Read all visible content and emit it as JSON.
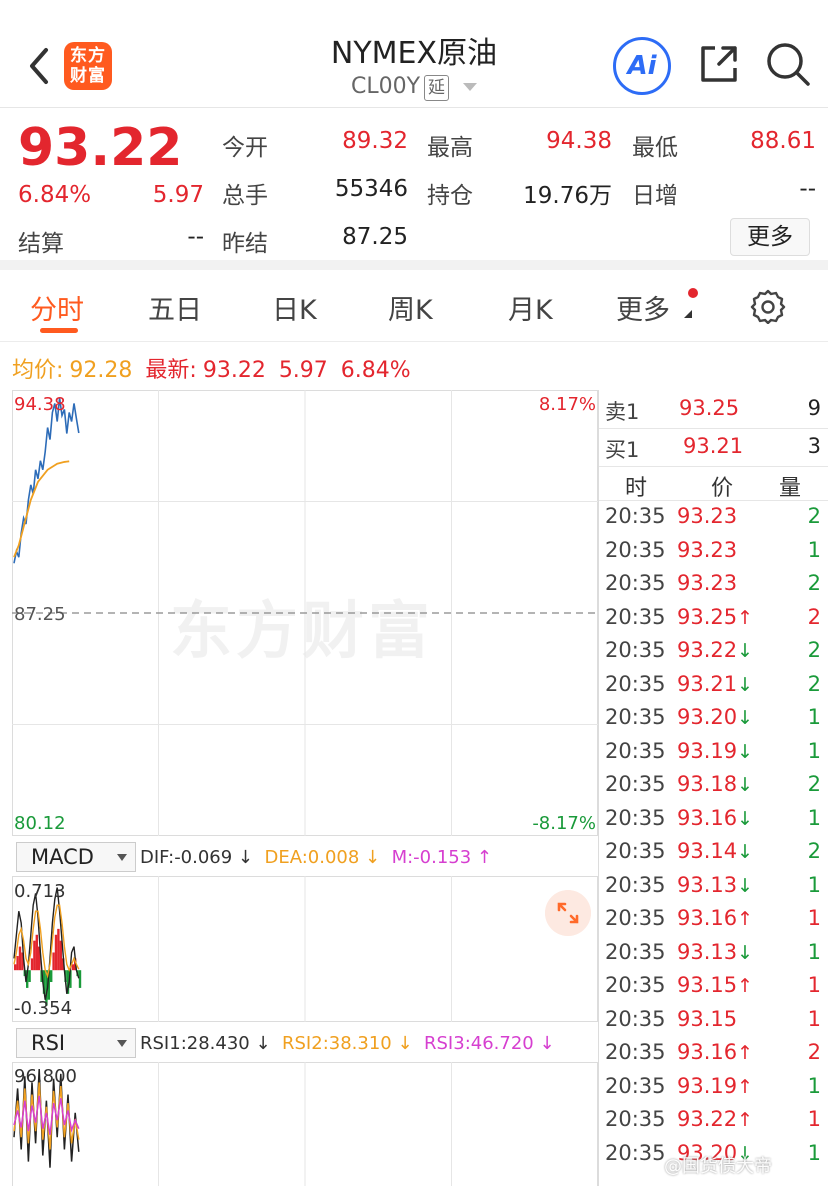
{
  "header": {
    "title": "NYMEX原油",
    "code": "CL00Y",
    "delay_badge": "延",
    "logo_line1": "东方",
    "logo_line2": "财富",
    "ai_label": "Ai"
  },
  "quote": {
    "price": "93.22",
    "pct": "6.84%",
    "change": "5.97",
    "fields": [
      {
        "label": "今开",
        "value": "89.32",
        "color": "#e3262e"
      },
      {
        "label": "最高",
        "value": "94.38",
        "color": "#e3262e"
      },
      {
        "label": "最低",
        "value": "88.61",
        "color": "#e3262e"
      },
      {
        "label": "总手",
        "value": "55346",
        "color": "#222222"
      },
      {
        "label": "持仓",
        "value": "19.76万",
        "color": "#222222"
      },
      {
        "label": "日增",
        "value": "--",
        "color": "#222222"
      },
      {
        "label": "结算",
        "value": "--",
        "color": "#222222"
      },
      {
        "label": "昨结",
        "value": "87.25",
        "color": "#222222"
      }
    ],
    "more_label": "更多"
  },
  "tabs": [
    "分时",
    "五日",
    "日K",
    "周K",
    "月K",
    "更多"
  ],
  "info_line": {
    "avg_label": "均价:",
    "avg_value": "92.28",
    "latest_label": "最新:",
    "latest_value": "93.22",
    "change": "5.97",
    "pct": "6.84%"
  },
  "chart_data": [
    {
      "type": "line",
      "title": "",
      "series": [
        {
          "name": "",
          "color": "#2d6cb8",
          "values": [
            88.9,
            89.3,
            89.1,
            89.9,
            90.4,
            90.2,
            91.0,
            91.5,
            91.2,
            92.0,
            91.7,
            92.3,
            92.0,
            92.6,
            93.4,
            93.0,
            93.9,
            94.2,
            93.6,
            94.38,
            93.8,
            94.0,
            93.2,
            93.9,
            93.6,
            94.2,
            93.7,
            93.22
          ]
        },
        {
          "name": "",
          "color": "#f0a020",
          "values": [
            89.1,
            89.3,
            89.5,
            89.8,
            90.1,
            90.4,
            90.7,
            91.0,
            91.2,
            91.4,
            91.6,
            91.7,
            91.8,
            91.9,
            92.0,
            92.05,
            92.1,
            92.15,
            92.2,
            92.22,
            92.24,
            92.26,
            92.27,
            92.28
          ]
        }
      ],
      "y_labels": {
        "top": "94.38",
        "mid": "87.25",
        "bottom": "80.12",
        "top_pct": "8.17%",
        "bottom_pct": "-8.17%"
      },
      "ylim": [
        80.12,
        94.38
      ],
      "reference": 87.25
    },
    {
      "type": "bar",
      "title": "MACD",
      "indicator_values": {
        "dif": "DIF:-0.069 ↓",
        "dea": "DEA:0.008 ↓",
        "m": "M:-0.153 ↑"
      },
      "y_labels": {
        "top": "0.713",
        "bottom": "-0.354"
      },
      "ylim": [
        -0.354,
        0.713
      ],
      "histogram": [
        0.05,
        0.12,
        0.2,
        0.15,
        -0.05,
        -0.15,
        -0.1,
        0.1,
        0.25,
        0.3,
        0.2,
        -0.1,
        -0.2,
        -0.3,
        -0.25,
        -0.1,
        0.15,
        0.3,
        0.35,
        0.25,
        0.1,
        -0.1,
        -0.2,
        -0.15,
        0.05,
        0.1,
        -0.05,
        -0.15
      ],
      "dif": [
        0.1,
        0.3,
        0.5,
        0.4,
        0.1,
        -0.1,
        0.05,
        0.3,
        0.55,
        0.65,
        0.45,
        0.15,
        -0.1,
        -0.25,
        -0.15,
        0.1,
        0.4,
        0.6,
        0.7,
        0.5,
        0.25,
        0.0,
        -0.2,
        -0.1,
        0.15,
        0.2,
        0.0,
        -0.069
      ],
      "dea": [
        0.05,
        0.15,
        0.3,
        0.35,
        0.25,
        0.1,
        0.05,
        0.15,
        0.35,
        0.5,
        0.5,
        0.35,
        0.15,
        0.0,
        -0.05,
        0.05,
        0.25,
        0.45,
        0.55,
        0.55,
        0.4,
        0.2,
        0.05,
        0.0,
        0.05,
        0.1,
        0.05,
        0.008
      ]
    },
    {
      "type": "line",
      "title": "RSI",
      "indicator_values": {
        "rsi1": "RSI1:28.430 ↓",
        "rsi2": "RSI2:38.310 ↓",
        "rsi3": "RSI3:46.720 ↓"
      },
      "y_labels": {
        "top": "96.800"
      },
      "ylim": [
        0,
        96.8
      ],
      "series": [
        {
          "name": "RSI1",
          "color": "#222222",
          "values": [
            40,
            80,
            30,
            90,
            20,
            85,
            35,
            96,
            25,
            70,
            15,
            88,
            40,
            92,
            30,
            75,
            20,
            60,
            28
          ]
        },
        {
          "name": "RSI2",
          "color": "#f0a020",
          "values": [
            45,
            70,
            40,
            80,
            35,
            75,
            45,
            85,
            38,
            65,
            30,
            78,
            48,
            82,
            40,
            68,
            35,
            55,
            38
          ]
        },
        {
          "name": "RSI3",
          "color": "#d63fd0",
          "values": [
            50,
            62,
            48,
            70,
            45,
            66,
            52,
            74,
            47,
            60,
            42,
            68,
            54,
            72,
            50,
            62,
            46,
            54,
            47
          ]
        }
      ]
    }
  ],
  "orderbook": {
    "sell_label": "卖1",
    "sell_price": "93.25",
    "sell_qty": "9",
    "buy_label": "买1",
    "buy_price": "93.21",
    "buy_qty": "3",
    "headers": [
      "时",
      "价",
      "量"
    ]
  },
  "ticks": [
    {
      "time": "20:35",
      "price": "93.23",
      "arrow": "",
      "qty": "2",
      "qty_color": "#1a9a3a"
    },
    {
      "time": "20:35",
      "price": "93.23",
      "arrow": "",
      "qty": "1",
      "qty_color": "#1a9a3a"
    },
    {
      "time": "20:35",
      "price": "93.23",
      "arrow": "",
      "qty": "2",
      "qty_color": "#1a9a3a"
    },
    {
      "time": "20:35",
      "price": "93.25",
      "arrow": "↑",
      "qty": "2",
      "qty_color": "#e3262e"
    },
    {
      "time": "20:35",
      "price": "93.22",
      "arrow": "↓",
      "qty": "2",
      "qty_color": "#1a9a3a"
    },
    {
      "time": "20:35",
      "price": "93.21",
      "arrow": "↓",
      "qty": "2",
      "qty_color": "#1a9a3a"
    },
    {
      "time": "20:35",
      "price": "93.20",
      "arrow": "↓",
      "qty": "1",
      "qty_color": "#1a9a3a"
    },
    {
      "time": "20:35",
      "price": "93.19",
      "arrow": "↓",
      "qty": "1",
      "qty_color": "#1a9a3a"
    },
    {
      "time": "20:35",
      "price": "93.18",
      "arrow": "↓",
      "qty": "2",
      "qty_color": "#1a9a3a"
    },
    {
      "time": "20:35",
      "price": "93.16",
      "arrow": "↓",
      "qty": "1",
      "qty_color": "#1a9a3a"
    },
    {
      "time": "20:35",
      "price": "93.14",
      "arrow": "↓",
      "qty": "2",
      "qty_color": "#1a9a3a"
    },
    {
      "time": "20:35",
      "price": "93.13",
      "arrow": "↓",
      "qty": "1",
      "qty_color": "#1a9a3a"
    },
    {
      "time": "20:35",
      "price": "93.16",
      "arrow": "↑",
      "qty": "1",
      "qty_color": "#e3262e"
    },
    {
      "time": "20:35",
      "price": "93.13",
      "arrow": "↓",
      "qty": "1",
      "qty_color": "#1a9a3a"
    },
    {
      "time": "20:35",
      "price": "93.15",
      "arrow": "↑",
      "qty": "1",
      "qty_color": "#e3262e"
    },
    {
      "time": "20:35",
      "price": "93.15",
      "arrow": "",
      "qty": "1",
      "qty_color": "#e3262e"
    },
    {
      "time": "20:35",
      "price": "93.16",
      "arrow": "↑",
      "qty": "2",
      "qty_color": "#e3262e"
    },
    {
      "time": "20:35",
      "price": "93.19",
      "arrow": "↑",
      "qty": "1",
      "qty_color": "#1a9a3a"
    },
    {
      "time": "20:35",
      "price": "93.22",
      "arrow": "↑",
      "qty": "1",
      "qty_color": "#e3262e"
    },
    {
      "time": "20:35",
      "price": "93.20",
      "arrow": "↓",
      "qty": "1",
      "qty_color": "#1a9a3a"
    }
  ],
  "watermark": "东方财富",
  "weibo_credit": "@国货债大帝",
  "colors": {
    "up": "#e3262e",
    "down": "#1a9a3a",
    "accent": "#ff5a1f",
    "ai": "#2d6cf6"
  }
}
